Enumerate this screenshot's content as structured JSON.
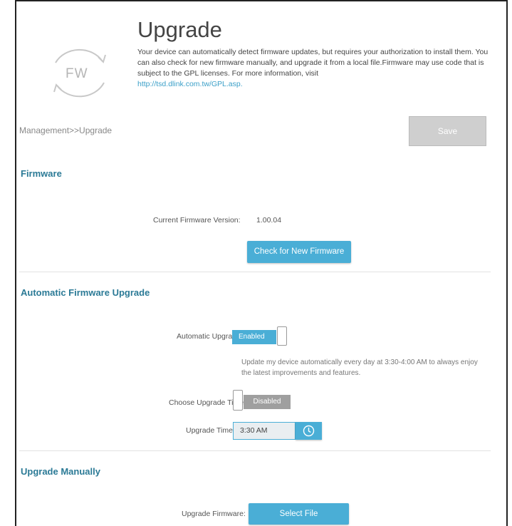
{
  "header": {
    "logo_text": "FW",
    "title": "Upgrade",
    "description": "Your device can automatically detect firmware updates, but requires your authorization to install them. You can also check for new firmware manually, and upgrade it from a local file.Firmware may use code that is subject to the GPL licenses. For more information, visit",
    "link": "http://tsd.dlink.com.tw/GPL.asp."
  },
  "breadcrumb": "Management>>Upgrade",
  "toolbar": {
    "save_label": "Save"
  },
  "firmware": {
    "section_title": "Firmware",
    "version_label": "Current Firmware Version:",
    "version_value": "1.00.04",
    "check_button": "Check for New Firmware"
  },
  "auto_upgrade": {
    "section_title": "Automatic Firmware Upgrade",
    "auto_label": "Automatic Upgrade:",
    "auto_state": "Enabled",
    "help_text": "Update my device automatically every day at 3:30-4:00 AM to always enjoy the latest improvements and features.",
    "choose_time_label": "Choose Upgrade Time:",
    "choose_time_state": "Disabled",
    "time_label": "Upgrade Time:",
    "time_value": "3:30 AM"
  },
  "manual": {
    "section_title": "Upgrade Manually",
    "upgrade_label": "Upgrade Firmware:",
    "select_button": "Select File"
  },
  "colors": {
    "accent": "#4aaed6",
    "section_title": "#2b7a96",
    "disabled": "#9f9f9f"
  }
}
